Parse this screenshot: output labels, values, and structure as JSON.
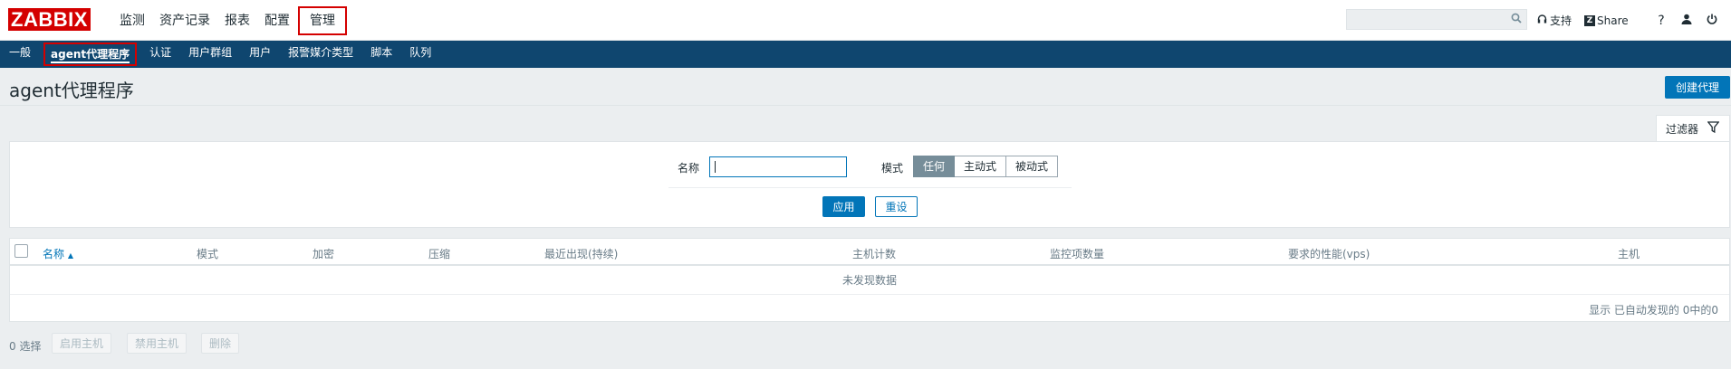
{
  "logo": {
    "text": "ZABBIX",
    "color": "#d40000"
  },
  "top_menu": [
    {
      "label": "监测",
      "active": false
    },
    {
      "label": "资产记录",
      "active": false
    },
    {
      "label": "报表",
      "active": false
    },
    {
      "label": "配置",
      "active": false
    },
    {
      "label": "管理",
      "active": true
    }
  ],
  "header": {
    "search_placeholder": "",
    "support_label": "支持",
    "share_badge": "Z",
    "share_label": "Share",
    "help_icon": "help-icon",
    "user_icon": "user-icon",
    "logout_icon": "power-icon"
  },
  "sub_menu": [
    {
      "label": "一般",
      "active": false
    },
    {
      "label": "agent代理程序",
      "active": true
    },
    {
      "label": "认证",
      "active": false
    },
    {
      "label": "用户群组",
      "active": false
    },
    {
      "label": "用户",
      "active": false
    },
    {
      "label": "报警媒介类型",
      "active": false
    },
    {
      "label": "脚本",
      "active": false
    },
    {
      "label": "队列",
      "active": false
    }
  ],
  "page": {
    "title": "agent代理程序",
    "create_button": "创建代理"
  },
  "filter": {
    "tab_label": "过滤器",
    "name_label": "名称",
    "name_value": "",
    "mode_label": "模式",
    "mode_options": [
      "任何",
      "主动式",
      "被动式"
    ],
    "mode_selected": "任何",
    "apply_label": "应用",
    "reset_label": "重设"
  },
  "table": {
    "columns": [
      "名称",
      "模式",
      "加密",
      "压缩",
      "最近出现(持续)",
      "主机计数",
      "监控项数量",
      "要求的性能(vps)",
      "主机"
    ],
    "sort_indicator": "▲",
    "empty_text": "未发现数据",
    "summary": "显示 已自动发现的 0中的0"
  },
  "footer": {
    "selected_count": "0 选择",
    "buttons": [
      "启用主机",
      "禁用主机",
      "删除"
    ]
  },
  "colors": {
    "accent": "#0275b8",
    "nav_bg": "#0f466f",
    "highlight_border": "#d40000",
    "page_bg": "#ebeef0"
  }
}
